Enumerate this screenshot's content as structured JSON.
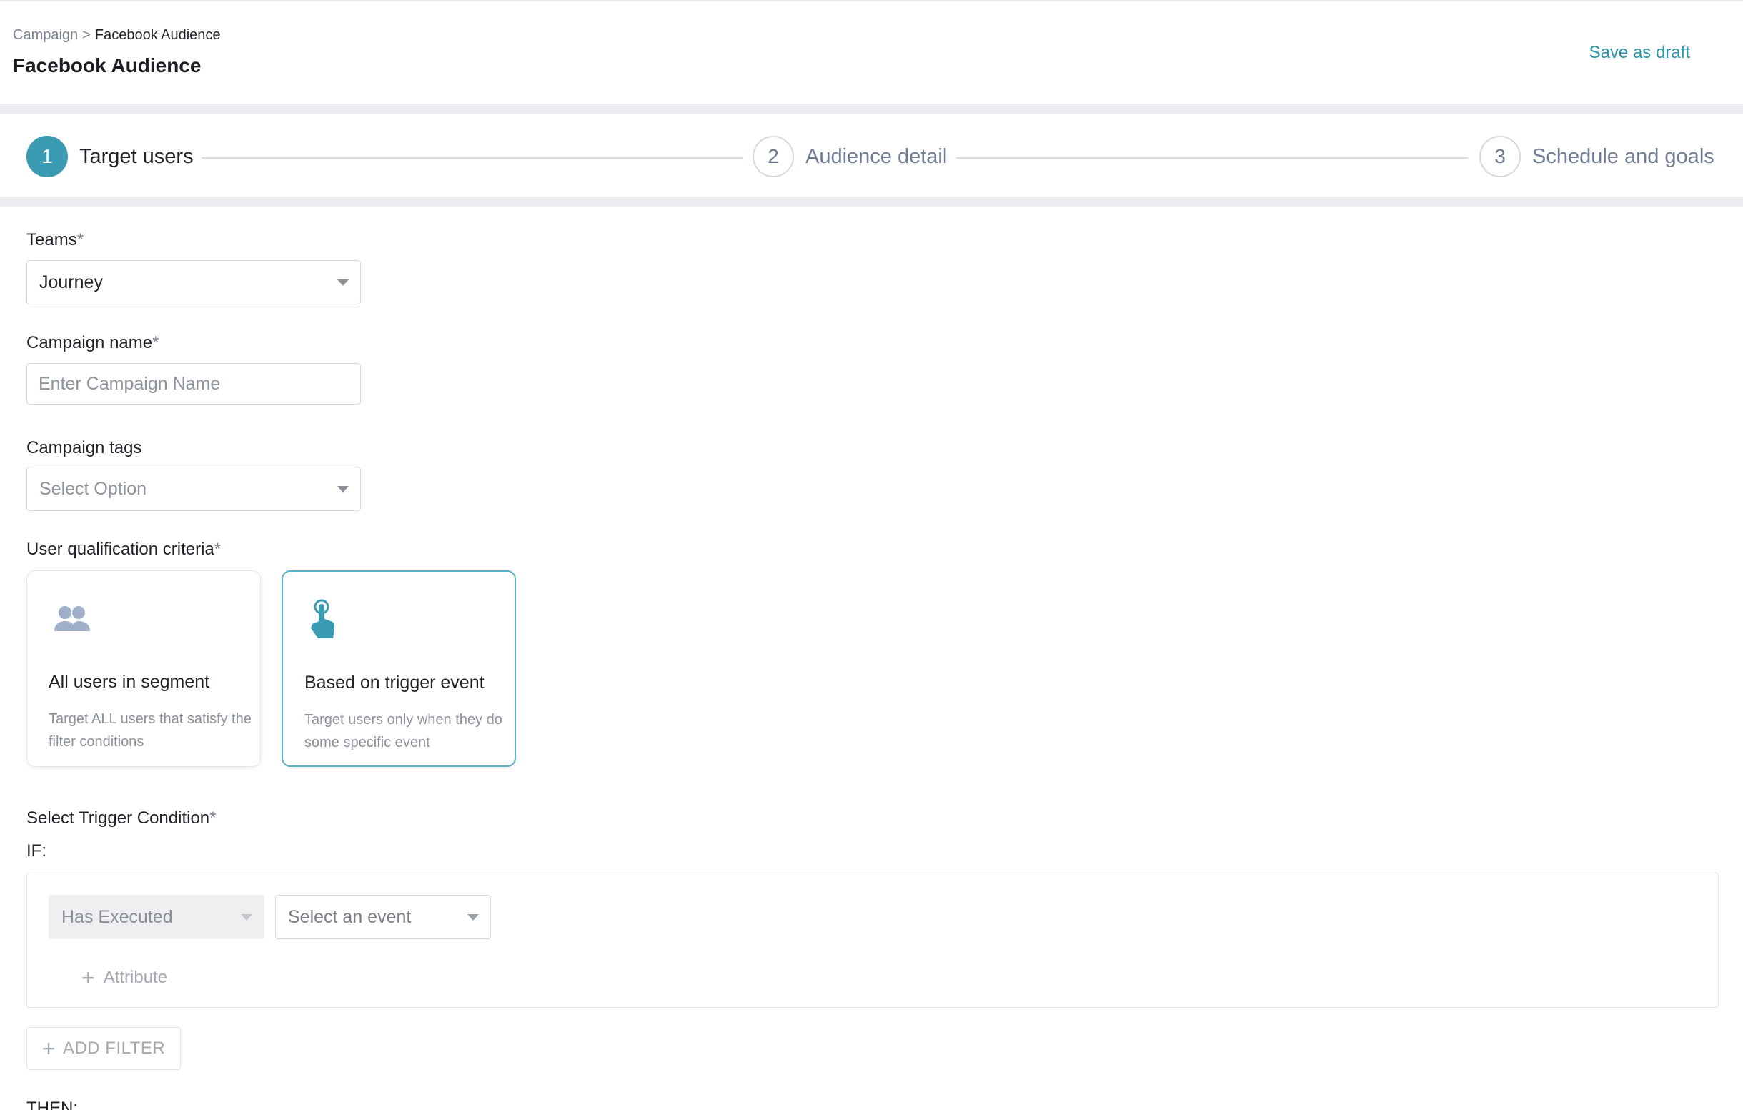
{
  "header": {
    "breadcrumb": {
      "parent": "Campaign",
      "separator": ">",
      "current": "Facebook Audience"
    },
    "title": "Facebook Audience",
    "save_draft_label": "Save as draft"
  },
  "stepper": {
    "steps": [
      {
        "number": "1",
        "label": "Target users",
        "active": true
      },
      {
        "number": "2",
        "label": "Audience detail",
        "active": false
      },
      {
        "number": "3",
        "label": "Schedule and goals",
        "active": false
      }
    ]
  },
  "form": {
    "teams": {
      "label": "Teams",
      "required_mark": "*",
      "value": "Journey"
    },
    "campaign_name": {
      "label": "Campaign name",
      "required_mark": "*",
      "placeholder": "Enter Campaign Name",
      "value": ""
    },
    "campaign_tags": {
      "label": "Campaign tags",
      "placeholder": "Select Option"
    },
    "qualification": {
      "label": "User qualification criteria",
      "required_mark": "*",
      "options": [
        {
          "icon": "users-group-icon",
          "title": "All users in segment",
          "description": "Target ALL users that satisfy the filter conditions",
          "selected": false
        },
        {
          "icon": "touch-pointer-icon",
          "title": "Based on trigger event",
          "description": "Target users only when they do some specific event",
          "selected": true
        }
      ]
    },
    "trigger": {
      "label": "Select Trigger Condition",
      "required_mark": "*",
      "if_label": "IF:",
      "condition_value": "Has Executed",
      "event_placeholder": "Select an event",
      "attribute_label": "Attribute",
      "add_filter_label": "ADD FILTER",
      "then_label": "THEN:"
    }
  },
  "colors": {
    "accent": "#3b9bb3",
    "link": "#2a97ad",
    "selected_border": "#5ab0c6",
    "icon_muted": "#9fb0c8"
  }
}
